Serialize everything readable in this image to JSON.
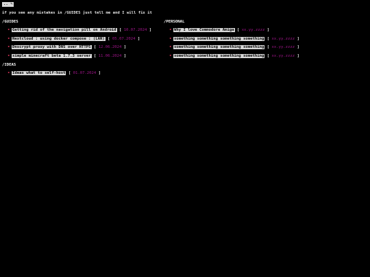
{
  "nav": {
    "label": ".. ✎"
  },
  "notice": "if you see any mistakes in /GUIDES just tell me and I will fix it",
  "guides": {
    "title": "/GUIDES",
    "items": [
      {
        "bullet": "•",
        "title": "Getting rid of the navigation pill on Android",
        "open": "[",
        "date": "10.07.2024",
        "close": "]"
      },
      {
        "bullet": "•",
        "title": "Nextcloud : using docker compose : (LAN)",
        "open": "[",
        "date": "05.07.2024",
        "close": "]"
      },
      {
        "bullet": "•",
        "title": "Dnscrypt proxy with DNS over HTTPS",
        "open": "[",
        "date": "12.06.2024",
        "close": "]"
      },
      {
        "bullet": "•",
        "title": "simple minecraft beta 1.7.3 server",
        "open": "[",
        "date": "11.06.2024",
        "close": "]"
      }
    ]
  },
  "personal": {
    "title": "/PERSONAL",
    "items": [
      {
        "bullet": "•",
        "title": "Why I love Commodore Amiga",
        "open": "[",
        "date": "xx.yy.zzzz",
        "close": "]"
      },
      {
        "bullet": "•",
        "title": "something something something something",
        "open": "[",
        "date": "xx.yy.zzzz",
        "close": "]"
      },
      {
        "bullet": "•",
        "title": "something something something something",
        "open": "[",
        "date": "xx.yy.zzzz",
        "close": "]"
      },
      {
        "bullet": "•",
        "title": "something something something something",
        "open": "[",
        "date": "xx.yy.zzzz",
        "close": "]"
      }
    ]
  },
  "ideas": {
    "title": "/IDEAS",
    "items": [
      {
        "bullet": "•",
        "title": "Ideas what to self-host",
        "open": "[",
        "date": "01.07.2024",
        "close": "]"
      }
    ]
  },
  "colors": {
    "background": "#000000",
    "text": "#e8e8e8",
    "link_bg": "#d8d8d8",
    "bullet": "#e0355a",
    "date": "#a0158a"
  }
}
